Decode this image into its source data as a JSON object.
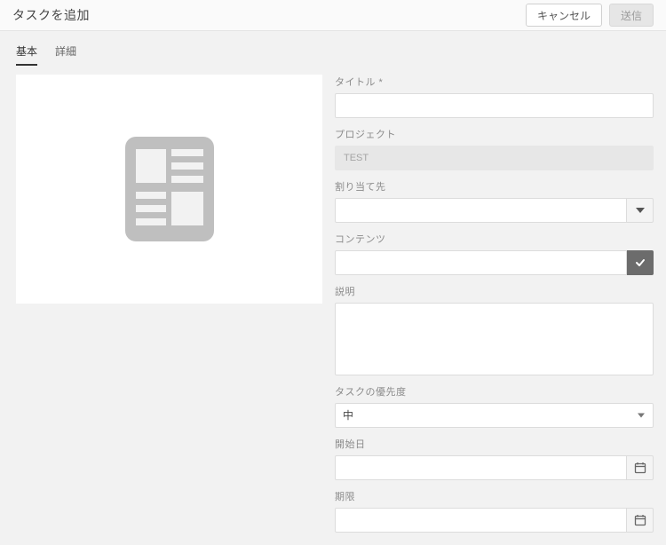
{
  "header": {
    "title": "タスクを追加",
    "cancel_label": "キャンセル",
    "submit_label": "送信"
  },
  "tabs": {
    "basic": "基本",
    "detail": "詳細"
  },
  "form": {
    "title_label": "タイトル *",
    "title_value": "",
    "project_label": "プロジェクト",
    "project_value": "TEST",
    "assignee_label": "割り当て先",
    "assignee_value": "",
    "content_label": "コンテンツ",
    "content_value": "",
    "description_label": "説明",
    "description_value": "",
    "priority_label": "タスクの優先度",
    "priority_value": "中",
    "start_date_label": "開始日",
    "start_date_value": "",
    "due_date_label": "期限",
    "due_date_value": ""
  }
}
